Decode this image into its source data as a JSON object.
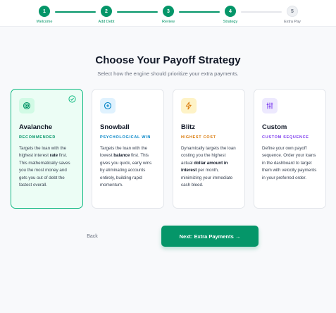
{
  "stepper": {
    "steps": [
      {
        "number": "1",
        "label": "Welcome",
        "state": "done"
      },
      {
        "number": "2",
        "label": "Add Debt",
        "state": "done"
      },
      {
        "number": "3",
        "label": "Review",
        "state": "done"
      },
      {
        "number": "4",
        "label": "Strategy",
        "state": "done"
      },
      {
        "number": "5",
        "label": "Extra Pay",
        "state": "todo"
      }
    ]
  },
  "header": {
    "title": "Choose Your Payoff Strategy",
    "subtitle": "Select how the engine should prioritize your extra payments."
  },
  "strategies": [
    {
      "name": "Avalanche",
      "tag": "RECOMMENDED",
      "tag_color": "#059669",
      "icon": "target-icon",
      "selected": true,
      "desc_1": "Targets the loan with the highest interest ",
      "desc_bold": "rate",
      "desc_2": " first. This mathematically saves you the most money and gets you out of debt the fastest overall."
    },
    {
      "name": "Snowball",
      "tag": "PSYCHOLOGICAL WIN",
      "tag_color": "#0284c7",
      "icon": "plus-circle-icon",
      "selected": false,
      "desc_1": "Targets the loan with the lowest ",
      "desc_bold": "balance",
      "desc_2": " first. This gives you quick, early wins by eliminating accounts entirely, building rapid momentum."
    },
    {
      "name": "Blitz",
      "tag": "HIGHEST COST",
      "tag_color": "#d97706",
      "icon": "lightning-icon",
      "selected": false,
      "desc_1": "Dynamically targets the loan costing you the highest actual ",
      "desc_bold": "dollar amount in interest",
      "desc_2": " per month, minimizing your immediate cash bleed."
    },
    {
      "name": "Custom",
      "tag": "CUSTOM SEQUENCE",
      "tag_color": "#7c3aed",
      "icon": "sliders-icon",
      "selected": false,
      "desc_1": "Define your own payoff sequence. Order your loans in the dashboard to target them with velocity payments in your preferred order.",
      "desc_bold": "",
      "desc_2": ""
    }
  ],
  "footer": {
    "back_label": "Back",
    "next_label": "Next: Extra Payments →"
  },
  "colors": {
    "accent": "#059669",
    "selected_bg": "#ecfdf5",
    "selected_border": "#10b981"
  }
}
